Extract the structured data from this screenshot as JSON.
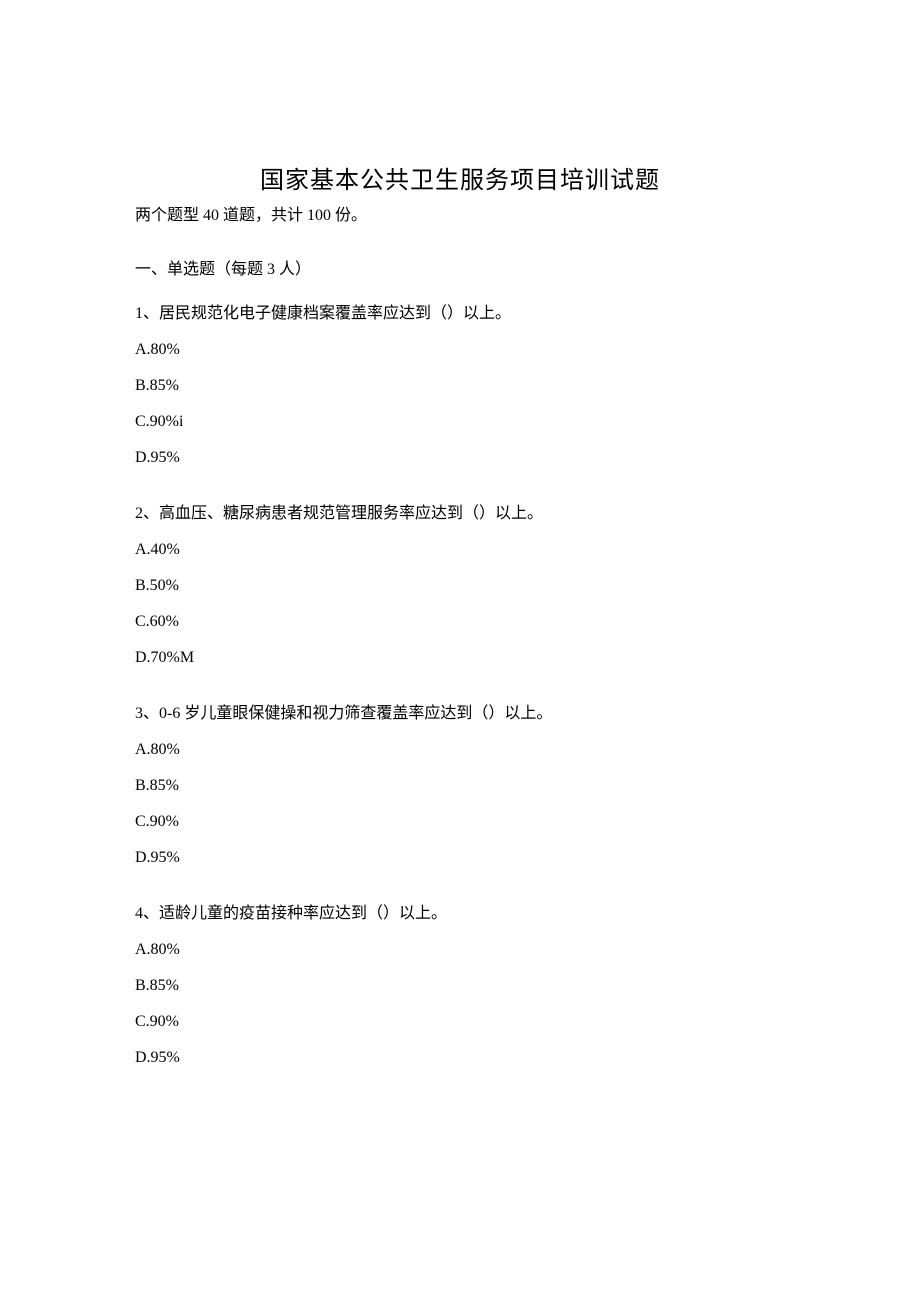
{
  "title": "国家基本公共卫生服务项目培训试题",
  "subtitle": "两个题型 40 道题，共计 100 份。",
  "section_header": "一、单选题（每题 3 人）",
  "questions": [
    {
      "text": "1、居民规范化电子健康档案覆盖率应达到（）以上。",
      "options": [
        "A.80%",
        "B.85%",
        "C.90%i",
        "D.95%"
      ]
    },
    {
      "text": "2、高血压、糖尿病患者规范管理服务率应达到（）以上。",
      "options": [
        "A.40%",
        "B.50%",
        "C.60%",
        "D.70%M"
      ]
    },
    {
      "text": "3、0-6 岁儿童眼保健操和视力筛查覆盖率应达到（）以上。",
      "options": [
        "A.80%",
        "B.85%",
        "C.90%",
        "D.95%"
      ]
    },
    {
      "text": "4、适龄儿童的疫苗接种率应达到（）以上。",
      "options": [
        "A.80%",
        "B.85%",
        "C.90%",
        "D.95%"
      ]
    }
  ]
}
